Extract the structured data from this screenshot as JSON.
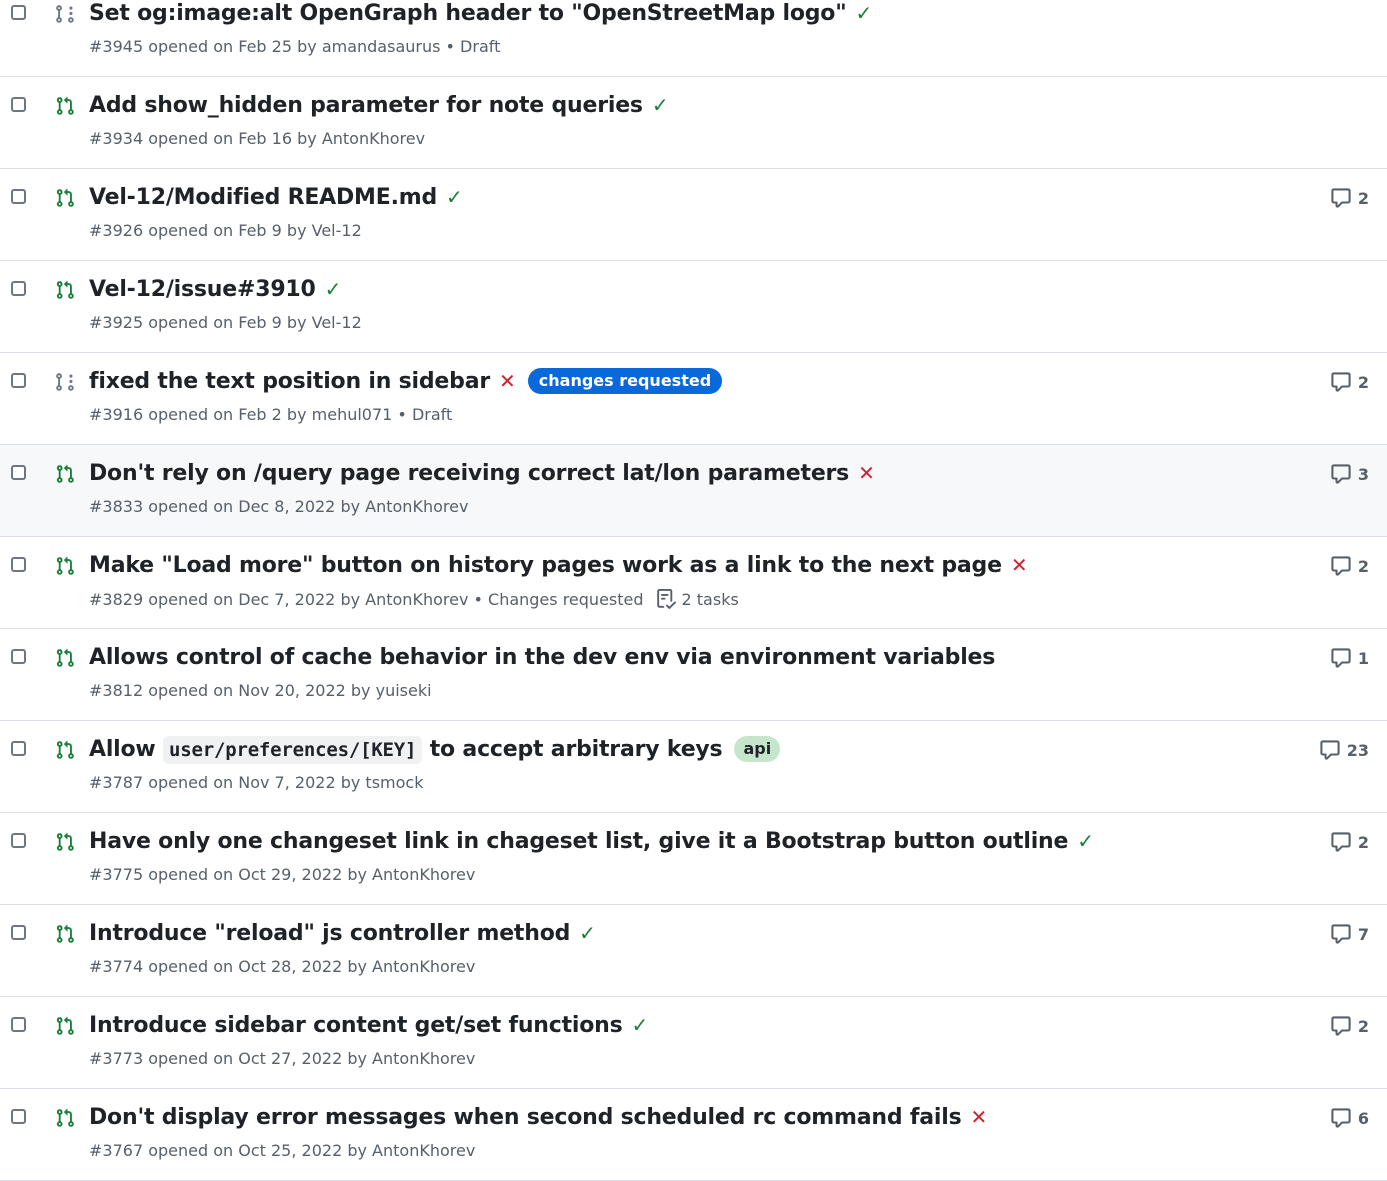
{
  "pull_requests": [
    {
      "title": "Set og:image:alt OpenGraph header to \"OpenStreetMap logo\"",
      "status": "success",
      "status_glyph": "✓",
      "meta": "#3945 opened on Feb 25 by amandasaurus • Draft",
      "comments": "",
      "draft": true
    },
    {
      "title": "Add show_hidden parameter for note queries",
      "status": "success",
      "status_glyph": "✓",
      "meta": "#3934 opened on Feb 16 by AntonKhorev",
      "comments": ""
    },
    {
      "title": "Vel-12/Modified README.md",
      "status": "success",
      "status_glyph": "✓",
      "meta": "#3926 opened on Feb 9 by Vel-12",
      "comments": "2"
    },
    {
      "title": "Vel-12/issue#3910",
      "status": "success",
      "status_glyph": "✓",
      "meta": "#3925 opened on Feb 9 by Vel-12",
      "comments": ""
    },
    {
      "title": "fixed the text position in sidebar",
      "status": "failure",
      "status_glyph": "✕",
      "label": "changes requested",
      "meta": "#3916 opened on Feb 2 by mehul071 • Draft",
      "comments": "2",
      "draft": true
    },
    {
      "title": "Don't rely on /query page receiving correct lat/lon parameters",
      "status": "failure",
      "status_glyph": "✕",
      "meta": "#3833 opened on Dec 8, 2022 by AntonKhorev",
      "comments": "3",
      "hover": true
    },
    {
      "title": "Make \"Load more\" button on history pages work as a link to the next page",
      "status": "failure",
      "status_glyph": "✕",
      "meta": "#3829 opened on Dec 7, 2022 by AntonKhorev • Changes requested",
      "tasks": "2 tasks",
      "comments": "2"
    },
    {
      "title": "Allows control of cache behavior in the dev env via environment variables",
      "status": "none",
      "status_glyph": "",
      "meta": "#3812 opened on Nov 20, 2022 by yuiseki",
      "comments": "1"
    },
    {
      "title_parts": [
        "Allow ",
        "user/preferences/[KEY]",
        " to accept arbitrary keys"
      ],
      "status": "none",
      "status_glyph": "",
      "label": "api",
      "meta": "#3787 opened on Nov 7, 2022 by tsmock",
      "comments": "23"
    },
    {
      "title": "Have only one changeset link in chageset list, give it a Bootstrap button outline",
      "status": "success",
      "status_glyph": "✓",
      "meta": "#3775 opened on Oct 29, 2022 by AntonKhorev",
      "comments": "2"
    },
    {
      "title": "Introduce \"reload\" js controller method",
      "status": "success",
      "status_glyph": "✓",
      "meta": "#3774 opened on Oct 28, 2022 by AntonKhorev",
      "comments": "7"
    },
    {
      "title": "Introduce sidebar content get/set functions",
      "status": "success",
      "status_glyph": "✓",
      "meta": "#3773 opened on Oct 27, 2022 by AntonKhorev",
      "comments": "2"
    },
    {
      "title": "Don't display error messages when second scheduled rc command fails",
      "status": "failure",
      "status_glyph": "✕",
      "meta": "#3767 opened on Oct 25, 2022 by AntonKhorev",
      "comments": "6"
    }
  ],
  "icons": {
    "open_pr": "git-pull-request-icon",
    "draft_pr": "git-pull-request-draft-icon",
    "comment": "comment-icon",
    "tasks": "checklist-icon"
  },
  "colors": {
    "open": "#1a7f37",
    "draft": "#6e7781",
    "success": "#1a7f37",
    "failure": "#cf222e",
    "label_changes": "#0969da",
    "label_api": "#c6e6cc"
  }
}
